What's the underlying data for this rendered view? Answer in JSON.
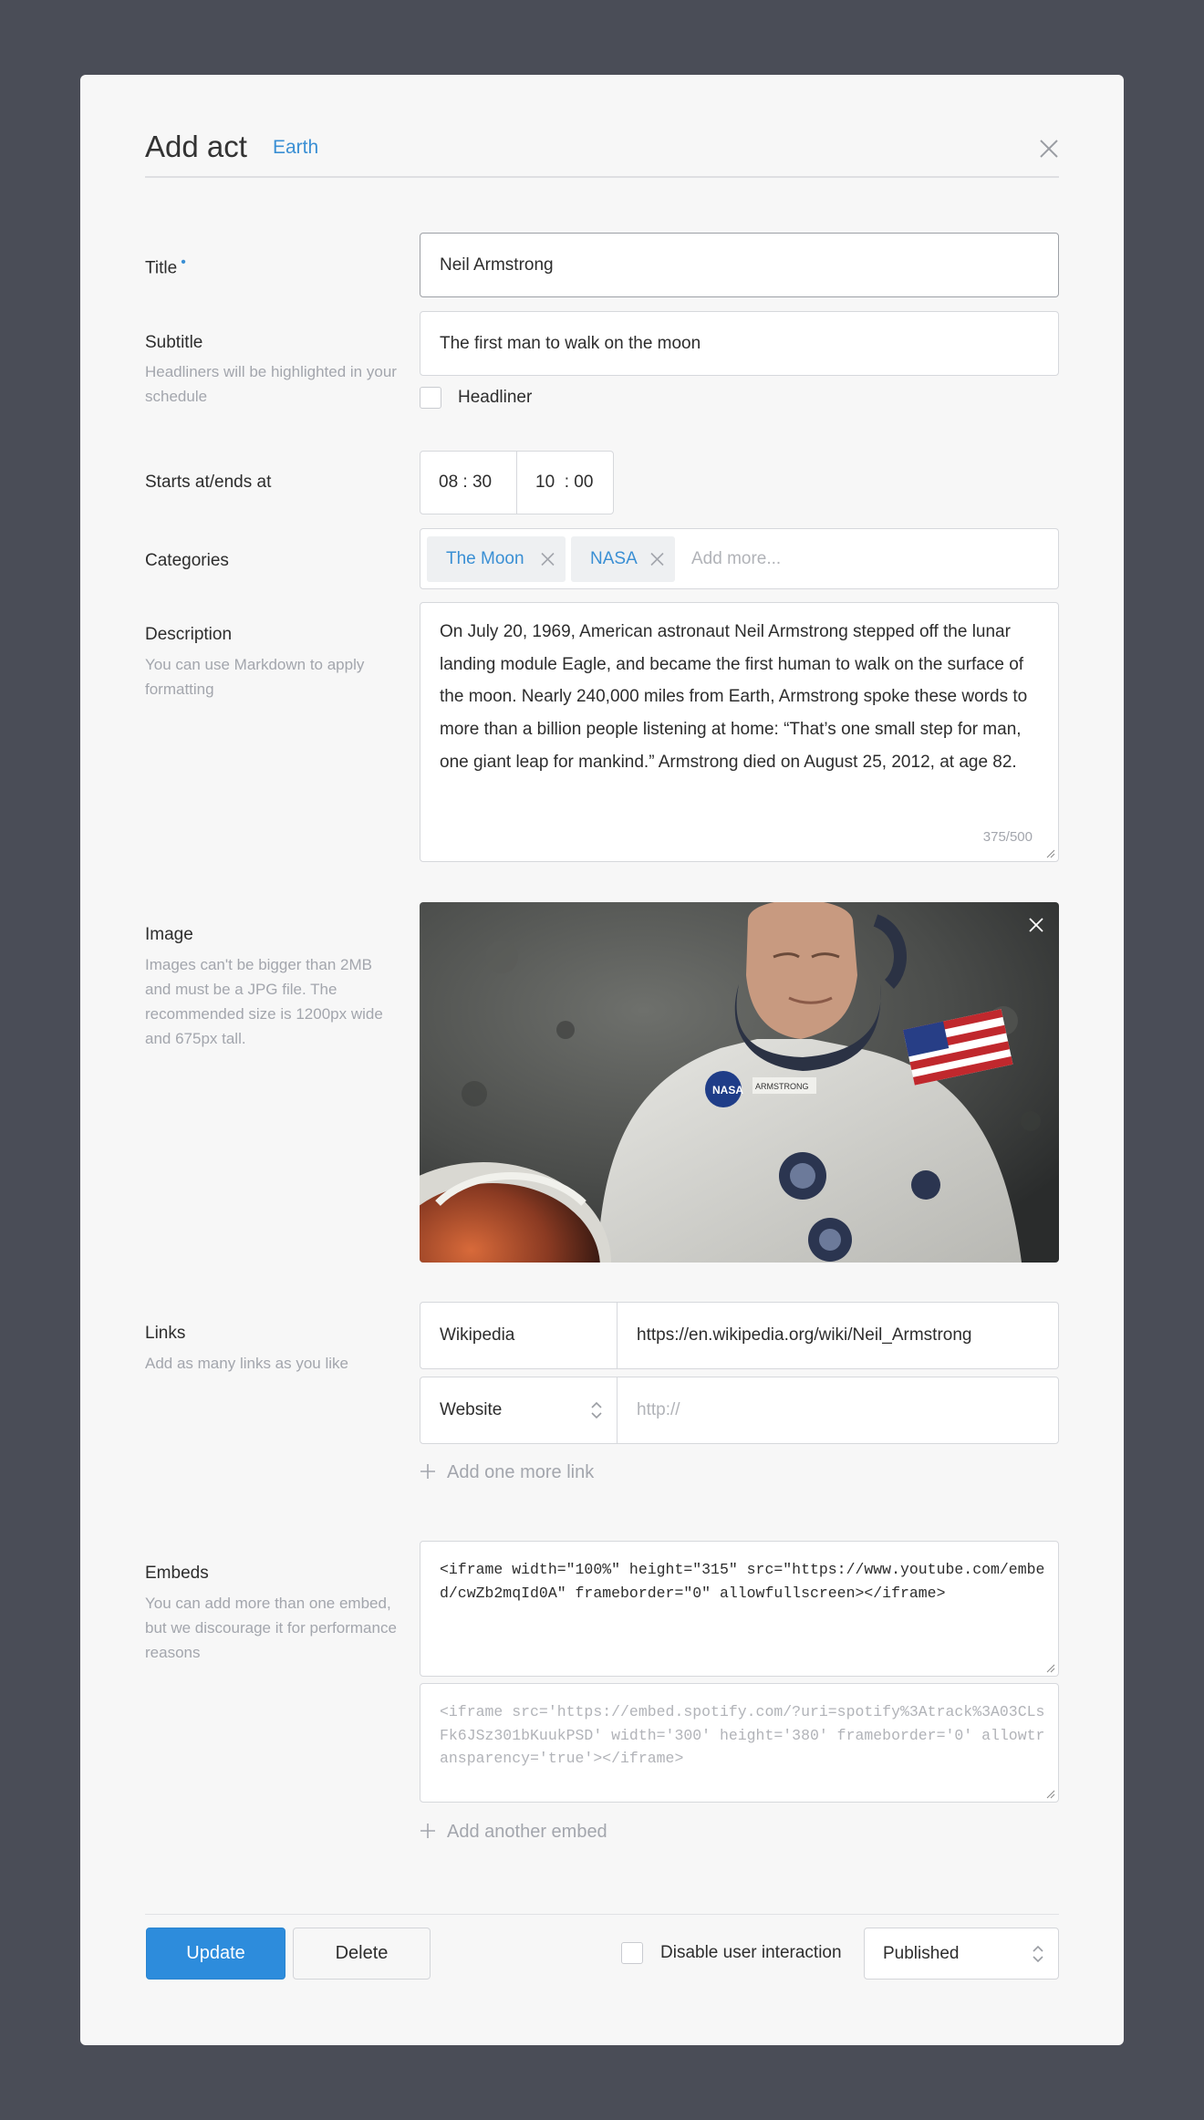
{
  "dialog": {
    "title": "Add act",
    "subtitle": "Earth"
  },
  "fields": {
    "title": {
      "label": "Title",
      "required_mark": "•",
      "value": "Neil Armstrong"
    },
    "subtitle": {
      "label": "Subtitle",
      "help": "Headliners will be highlighted in your schedule",
      "value": "The first man to walk on the moon",
      "headliner_label": "Headliner"
    },
    "times": {
      "label": "Starts at/ends at",
      "start": "08 : 30",
      "end": "10  : 00"
    },
    "categories": {
      "label": "Categories",
      "tags": [
        "The Moon",
        "NASA"
      ],
      "placeholder": "Add more..."
    },
    "description": {
      "label": "Description",
      "help": "You can use Markdown to apply formatting",
      "value": "On July 20, 1969, American astronaut Neil Armstrong stepped off the lunar landing module Eagle, and became the first human to walk on the surface of the moon. Nearly 240,000 miles from Earth, Armstrong spoke these words to more than a billion people listening at home: “That’s one small step for man, one giant leap for mankind.” Armstrong died on August 25, 2012, at age 82.",
      "counter": "375/500"
    },
    "image": {
      "label": "Image",
      "help": "Images can't be bigger than 2MB and must be a JPG file. The recommended size is 1200px wide and 675px tall.",
      "badge_text": "NASA",
      "name_tag": "ARMSTRONG"
    },
    "links": {
      "label": "Links",
      "help": "Add as many links as you like",
      "rows": [
        {
          "type": "Wikipedia",
          "url": "https://en.wikipedia.org/wiki/Neil_Armstrong"
        },
        {
          "type": "Website",
          "url": "",
          "url_placeholder": "http://"
        }
      ],
      "add_label": "Add one more link"
    },
    "embeds": {
      "label": "Embeds",
      "help": "You can add more than one embed, but we discourage it for performance reasons",
      "first": "<iframe width=\"100%\" height=\"315\" src=\"https://www.youtube.com/embed/cwZb2mqId0A\" frameborder=\"0\" allowfullscreen></iframe>",
      "second_placeholder": "<iframe src='https://embed.spotify.com/?uri=spotify%3Atrack%3A03CLsFk6JSz301bKuukPSD' width='300' height='380' frameborder='0' allowtransparency='true'></iframe>",
      "add_label": "Add another embed"
    }
  },
  "footer": {
    "update": "Update",
    "delete": "Delete",
    "disable_label": "Disable user interaction",
    "status": "Published"
  },
  "colors": {
    "accent": "#2d8cdc",
    "link": "#3a8fd4",
    "backdrop": "#4a4d57",
    "modal": "#f7f7f7"
  }
}
